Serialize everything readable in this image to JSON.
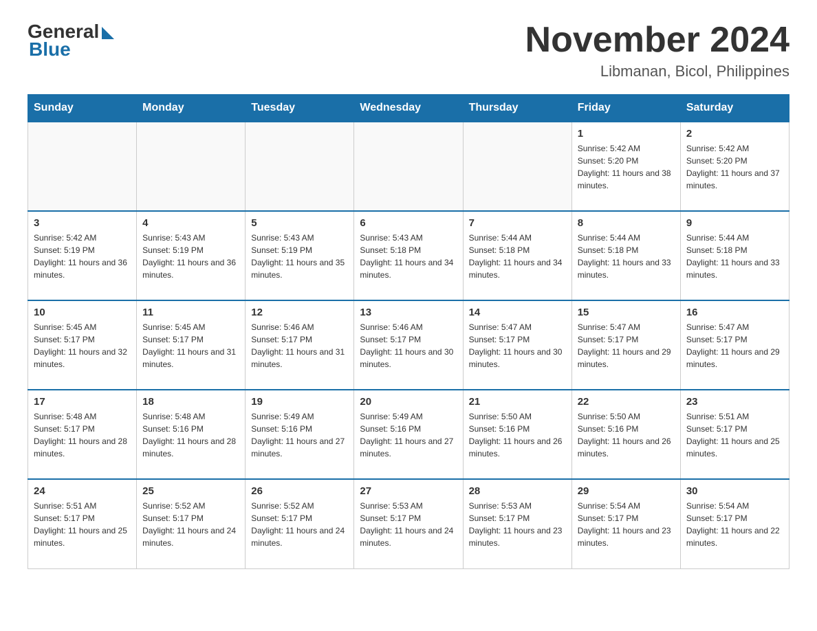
{
  "header": {
    "logo": {
      "general": "General",
      "blue": "Blue"
    },
    "month_title": "November 2024",
    "location": "Libmanan, Bicol, Philippines"
  },
  "weekdays": [
    "Sunday",
    "Monday",
    "Tuesday",
    "Wednesday",
    "Thursday",
    "Friday",
    "Saturday"
  ],
  "weeks": [
    [
      {
        "day": "",
        "info": ""
      },
      {
        "day": "",
        "info": ""
      },
      {
        "day": "",
        "info": ""
      },
      {
        "day": "",
        "info": ""
      },
      {
        "day": "",
        "info": ""
      },
      {
        "day": "1",
        "info": "Sunrise: 5:42 AM\nSunset: 5:20 PM\nDaylight: 11 hours and 38 minutes."
      },
      {
        "day": "2",
        "info": "Sunrise: 5:42 AM\nSunset: 5:20 PM\nDaylight: 11 hours and 37 minutes."
      }
    ],
    [
      {
        "day": "3",
        "info": "Sunrise: 5:42 AM\nSunset: 5:19 PM\nDaylight: 11 hours and 36 minutes."
      },
      {
        "day": "4",
        "info": "Sunrise: 5:43 AM\nSunset: 5:19 PM\nDaylight: 11 hours and 36 minutes."
      },
      {
        "day": "5",
        "info": "Sunrise: 5:43 AM\nSunset: 5:19 PM\nDaylight: 11 hours and 35 minutes."
      },
      {
        "day": "6",
        "info": "Sunrise: 5:43 AM\nSunset: 5:18 PM\nDaylight: 11 hours and 34 minutes."
      },
      {
        "day": "7",
        "info": "Sunrise: 5:44 AM\nSunset: 5:18 PM\nDaylight: 11 hours and 34 minutes."
      },
      {
        "day": "8",
        "info": "Sunrise: 5:44 AM\nSunset: 5:18 PM\nDaylight: 11 hours and 33 minutes."
      },
      {
        "day": "9",
        "info": "Sunrise: 5:44 AM\nSunset: 5:18 PM\nDaylight: 11 hours and 33 minutes."
      }
    ],
    [
      {
        "day": "10",
        "info": "Sunrise: 5:45 AM\nSunset: 5:17 PM\nDaylight: 11 hours and 32 minutes."
      },
      {
        "day": "11",
        "info": "Sunrise: 5:45 AM\nSunset: 5:17 PM\nDaylight: 11 hours and 31 minutes."
      },
      {
        "day": "12",
        "info": "Sunrise: 5:46 AM\nSunset: 5:17 PM\nDaylight: 11 hours and 31 minutes."
      },
      {
        "day": "13",
        "info": "Sunrise: 5:46 AM\nSunset: 5:17 PM\nDaylight: 11 hours and 30 minutes."
      },
      {
        "day": "14",
        "info": "Sunrise: 5:47 AM\nSunset: 5:17 PM\nDaylight: 11 hours and 30 minutes."
      },
      {
        "day": "15",
        "info": "Sunrise: 5:47 AM\nSunset: 5:17 PM\nDaylight: 11 hours and 29 minutes."
      },
      {
        "day": "16",
        "info": "Sunrise: 5:47 AM\nSunset: 5:17 PM\nDaylight: 11 hours and 29 minutes."
      }
    ],
    [
      {
        "day": "17",
        "info": "Sunrise: 5:48 AM\nSunset: 5:17 PM\nDaylight: 11 hours and 28 minutes."
      },
      {
        "day": "18",
        "info": "Sunrise: 5:48 AM\nSunset: 5:16 PM\nDaylight: 11 hours and 28 minutes."
      },
      {
        "day": "19",
        "info": "Sunrise: 5:49 AM\nSunset: 5:16 PM\nDaylight: 11 hours and 27 minutes."
      },
      {
        "day": "20",
        "info": "Sunrise: 5:49 AM\nSunset: 5:16 PM\nDaylight: 11 hours and 27 minutes."
      },
      {
        "day": "21",
        "info": "Sunrise: 5:50 AM\nSunset: 5:16 PM\nDaylight: 11 hours and 26 minutes."
      },
      {
        "day": "22",
        "info": "Sunrise: 5:50 AM\nSunset: 5:16 PM\nDaylight: 11 hours and 26 minutes."
      },
      {
        "day": "23",
        "info": "Sunrise: 5:51 AM\nSunset: 5:17 PM\nDaylight: 11 hours and 25 minutes."
      }
    ],
    [
      {
        "day": "24",
        "info": "Sunrise: 5:51 AM\nSunset: 5:17 PM\nDaylight: 11 hours and 25 minutes."
      },
      {
        "day": "25",
        "info": "Sunrise: 5:52 AM\nSunset: 5:17 PM\nDaylight: 11 hours and 24 minutes."
      },
      {
        "day": "26",
        "info": "Sunrise: 5:52 AM\nSunset: 5:17 PM\nDaylight: 11 hours and 24 minutes."
      },
      {
        "day": "27",
        "info": "Sunrise: 5:53 AM\nSunset: 5:17 PM\nDaylight: 11 hours and 24 minutes."
      },
      {
        "day": "28",
        "info": "Sunrise: 5:53 AM\nSunset: 5:17 PM\nDaylight: 11 hours and 23 minutes."
      },
      {
        "day": "29",
        "info": "Sunrise: 5:54 AM\nSunset: 5:17 PM\nDaylight: 11 hours and 23 minutes."
      },
      {
        "day": "30",
        "info": "Sunrise: 5:54 AM\nSunset: 5:17 PM\nDaylight: 11 hours and 22 minutes."
      }
    ]
  ]
}
